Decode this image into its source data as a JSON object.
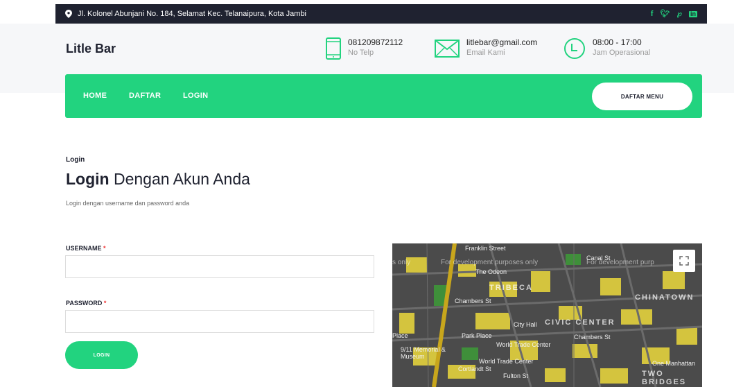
{
  "topbar": {
    "address": "Jl. Kolonel Abunjani No. 184, Selamat Kec. Telanaipura, Kota Jambi",
    "socials": [
      "facebook-icon",
      "twitter-icon",
      "pinterest-icon",
      "linkedin-icon"
    ]
  },
  "header": {
    "brand": "Litle Bar",
    "phone": {
      "value": "081209872112",
      "label": "No Telp"
    },
    "email": {
      "value": "litlebar@gmail.com",
      "label": "Email Kami"
    },
    "hours": {
      "value": "08:00 - 17:00",
      "label": "Jam Operasional"
    }
  },
  "nav": {
    "links": [
      "HOME",
      "DAFTAR",
      "LOGIN"
    ],
    "menu_button": "DAFTAR MENU"
  },
  "page": {
    "breadcrumb": "Login",
    "title_bold": "Login",
    "title_rest": " Dengan Akun Anda",
    "subtitle": "Login dengan username dan password anda"
  },
  "form": {
    "username_label": "USERNAME",
    "password_label": "PASSWORD",
    "required_mark": "*",
    "submit": "LOGIN"
  },
  "map": {
    "watermarks": [
      "s only",
      "For development purposes only",
      "For development purp"
    ],
    "areas": [
      "TRIBECA",
      "CIVIC CENTER",
      "CHINATOWN",
      "TWO BRIDGES"
    ],
    "labels": [
      "Franklin Street",
      "Canal St",
      "The Odeon",
      "Chambers St",
      "City Hall",
      "Park Place",
      "World Trade Center",
      "Chambers St",
      "9/11 Memorial & Museum",
      "World Trade Center",
      "Cortlandt St",
      "Fulton St",
      "One Manhattan",
      "Place"
    ]
  },
  "colors": {
    "accent": "#22d37f",
    "dark": "#1f2230"
  }
}
